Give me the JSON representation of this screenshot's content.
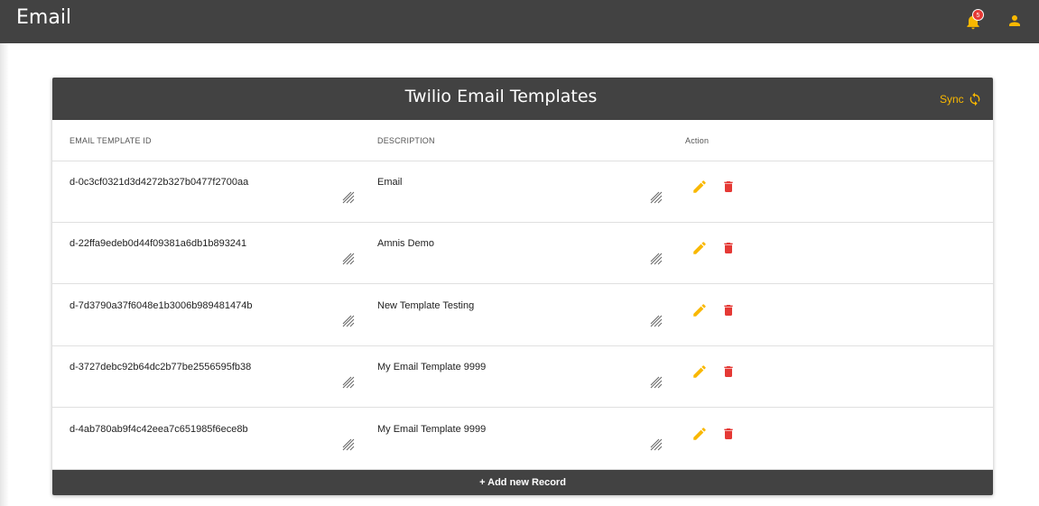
{
  "app": {
    "title": "Email",
    "notification_count": "5"
  },
  "card": {
    "title": "Twilio Email Templates",
    "sync_label": "Sync",
    "accent_color": "#f9b800",
    "delete_color": "#e53935",
    "header_color": "#424242"
  },
  "table": {
    "columns": {
      "id": "EMAIL TEMPLATE ID",
      "description": "DESCRIPTION",
      "action": "Action"
    },
    "rows": [
      {
        "id": "d-0c3cf0321d3d4272b327b0477f2700aa",
        "description": "Email"
      },
      {
        "id": "d-22ffa9edeb0d44f09381a6db1b893241",
        "description": "Amnis Demo"
      },
      {
        "id": "d-7d3790a37f6048e1b3006b989481474b",
        "description": "New Template Testing"
      },
      {
        "id": "d-3727debc92b64dc2b77be2556595fb38",
        "description": "My Email Template 9999"
      },
      {
        "id": "d-4ab780ab9f4c42eea7c651985f6ece8b",
        "description": "My Email Template 9999"
      }
    ]
  },
  "footer": {
    "add_label": "+ Add new Record"
  },
  "icons": {
    "notifications": "bell-icon",
    "account": "user-icon",
    "sync": "sync-icon",
    "edit": "pencil-icon",
    "delete": "trash-icon",
    "resize": "resize-grip-icon"
  }
}
